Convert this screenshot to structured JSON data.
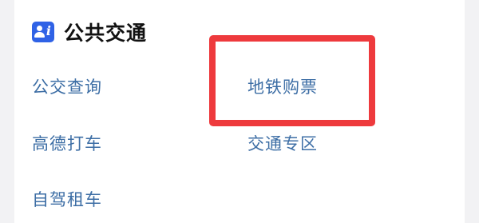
{
  "section": {
    "title": "公共交通",
    "icon": "contact-info-icon"
  },
  "items": [
    {
      "label": "公交查询"
    },
    {
      "label": "地铁购票"
    },
    {
      "label": "高德打车"
    },
    {
      "label": "交通专区"
    },
    {
      "label": "自驾租车"
    }
  ],
  "colors": {
    "accent": "#2f62e6",
    "link_text": "#3d6ea5",
    "highlight_border": "#ee3a3d"
  }
}
